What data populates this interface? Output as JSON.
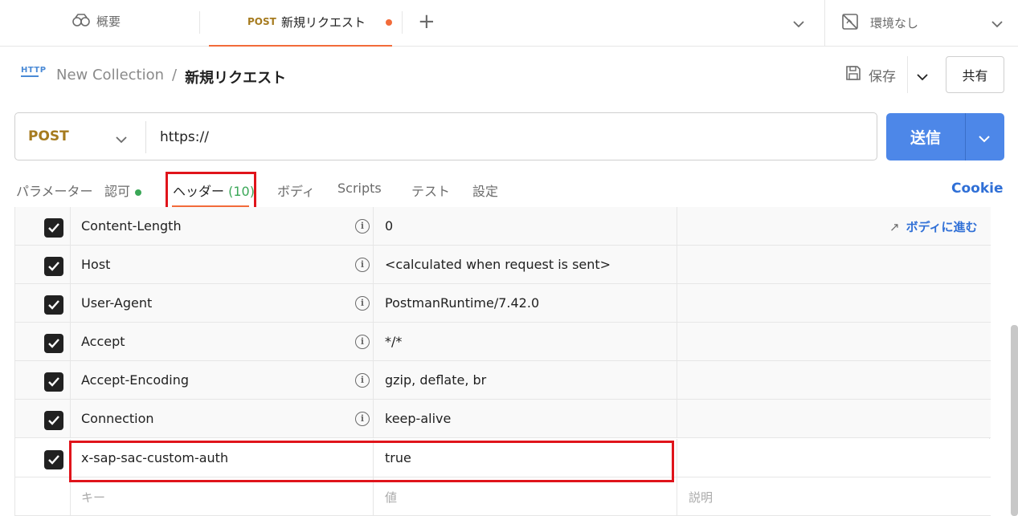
{
  "tabs": {
    "overview_label": "概要",
    "active_method": "POST",
    "active_name": "新規リクエスト",
    "add_label": "+"
  },
  "environment": {
    "label": "環境なし"
  },
  "breadcrumb": {
    "icon_text": "HTTP",
    "collection": "New Collection",
    "separator": "/",
    "request": "新規リクエスト"
  },
  "toolbar": {
    "save_label": "保存",
    "share_label": "共有"
  },
  "request": {
    "method": "POST",
    "url": "https://",
    "send_label": "送信"
  },
  "request_tabs": [
    {
      "label": "パラメーター"
    },
    {
      "label": "認可"
    },
    {
      "label": "ヘッダー",
      "count": "(10)"
    },
    {
      "label": "ボディ"
    },
    {
      "label": "Scripts"
    },
    {
      "label": "テスト"
    },
    {
      "label": "設定"
    }
  ],
  "cookie_label": "Cookie",
  "go_to_body_label": "ボディに進む",
  "headers": [
    {
      "key": "Content-Length",
      "value": "0"
    },
    {
      "key": "Host",
      "value": "<calculated when request is sent>"
    },
    {
      "key": "User-Agent",
      "value": "PostmanRuntime/7.42.0"
    },
    {
      "key": "Accept",
      "value": "*/*"
    },
    {
      "key": "Accept-Encoding",
      "value": "gzip, deflate, br"
    },
    {
      "key": "Connection",
      "value": "keep-alive"
    },
    {
      "key": "x-sap-sac-custom-auth",
      "value": "true"
    }
  ],
  "new_row": {
    "key_placeholder": "キー",
    "value_placeholder": "値",
    "description_placeholder": "説明"
  },
  "colors": {
    "accent": "#f26b3a",
    "send": "#4d87e8",
    "highlight": "#e0141b",
    "method": "#a67b1f",
    "link": "#2f6fd6"
  }
}
